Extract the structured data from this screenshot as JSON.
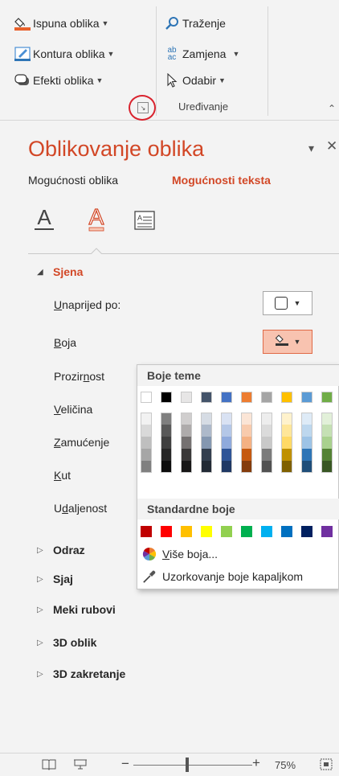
{
  "ribbon": {
    "fill_label": "Ispuna oblika",
    "outline_label": "Kontura oblika",
    "effects_label": "Efekti oblika",
    "find_label": "Traženje",
    "replace_label": "Zamjena",
    "select_label": "Odabir",
    "group_label": "Uređivanje",
    "replace_icon_top": "ab",
    "replace_icon_bottom": "ac"
  },
  "pane": {
    "title": "Oblikovanje oblika",
    "close_glyph": "✕",
    "menu_glyph": "▾",
    "tab_shape": "Mogućnosti oblika",
    "tab_text": "Mogućnosti teksta"
  },
  "sections": {
    "shadow": {
      "title": "Sjena",
      "presets": {
        "underlined": "U",
        "rest": "naprijed po:"
      },
      "color": {
        "underlined": "B",
        "rest": "oja"
      },
      "transparency": {
        "before": "Prozir",
        "underlined": "n",
        "after": "ost"
      },
      "size": {
        "underlined": "V",
        "rest": "eličina"
      },
      "blur": {
        "underlined": "Z",
        "rest": "amućenje"
      },
      "angle": {
        "underlined": "K",
        "rest": "ut"
      },
      "distance": {
        "before": "U",
        "underlined": "d",
        "after": "aljenost"
      }
    },
    "reflection": "Odraz",
    "glow": "Sjaj",
    "soft_edges": "Meki rubovi",
    "format_3d": "3D oblik",
    "rotation_3d": "3D zakretanje"
  },
  "dropdown": {
    "theme_colors_label": "Boje teme",
    "standard_colors_label": "Standardne boje",
    "more_colors_underlined": "V",
    "more_colors_rest": "iše boja...",
    "eyedropper_label": "Uzorkovanje boje kapaljkom",
    "theme_top": [
      "#ffffff",
      "#000000",
      "#e7e6e6",
      "#44546a",
      "#4472c4",
      "#ed7d31",
      "#a5a5a5",
      "#ffc000",
      "#5b9bd5",
      "#70ad47"
    ],
    "theme_shades": [
      [
        "#f2f2f2",
        "#d9d9d9",
        "#bfbfbf",
        "#a6a6a6",
        "#808080"
      ],
      [
        "#7f7f7f",
        "#595959",
        "#3f3f3f",
        "#262626",
        "#0d0d0d"
      ],
      [
        "#d0cece",
        "#aeabab",
        "#757171",
        "#3a3838",
        "#171616"
      ],
      [
        "#d6dce4",
        "#adb9ca",
        "#8497b0",
        "#333f4f",
        "#222a35"
      ],
      [
        "#d9e2f3",
        "#b4c7e7",
        "#8faadc",
        "#2f5597",
        "#1f3864"
      ],
      [
        "#fbe5d6",
        "#f8cbad",
        "#f4b183",
        "#c55a11",
        "#843c0c"
      ],
      [
        "#ededed",
        "#dbdbdb",
        "#c9c9c9",
        "#7b7b7b",
        "#525252"
      ],
      [
        "#fff2cc",
        "#ffe699",
        "#ffd966",
        "#bf9000",
        "#7f6000"
      ],
      [
        "#deebf7",
        "#bdd7ee",
        "#9dc3e6",
        "#2e75b6",
        "#1f4e79"
      ],
      [
        "#e2f0d9",
        "#c5e0b4",
        "#a9d18e",
        "#548235",
        "#385723"
      ]
    ],
    "standard": [
      "#c00000",
      "#ff0000",
      "#ffc000",
      "#ffff00",
      "#92d050",
      "#00b050",
      "#00b0f0",
      "#0070c0",
      "#002060",
      "#7030a0"
    ]
  },
  "statusbar": {
    "zoom": "75%",
    "minus": "−",
    "plus": "+"
  },
  "colors": {
    "accent": "#d24726",
    "annotation_circle": "#d9232e"
  }
}
